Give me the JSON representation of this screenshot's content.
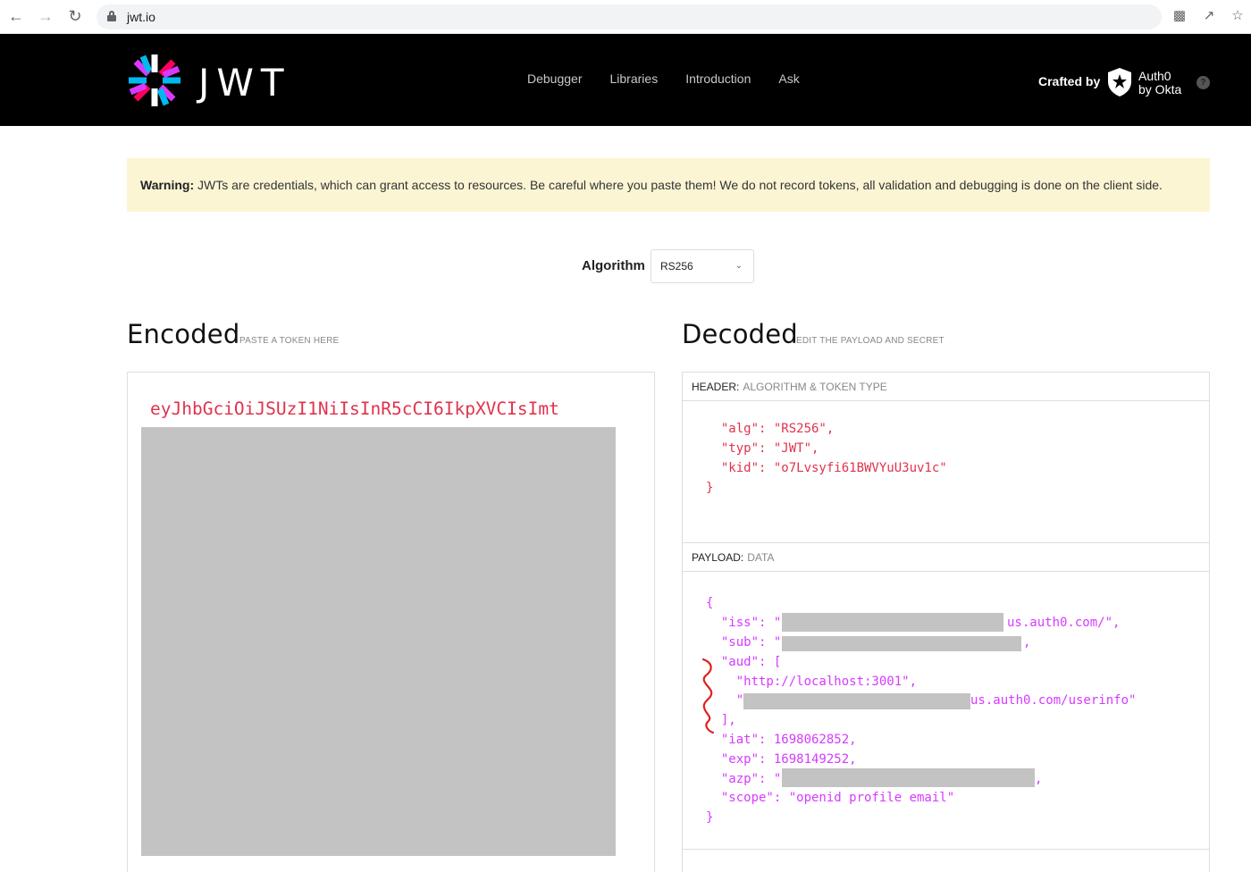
{
  "browser": {
    "url": "jwt.io"
  },
  "header": {
    "logo_text": "JWT",
    "nav": [
      "Debugger",
      "Libraries",
      "Introduction",
      "Ask"
    ],
    "crafted_by": "Crafted by",
    "auth0_line1": "Auth0",
    "auth0_line2": "by Okta",
    "help": "?"
  },
  "warning": {
    "bold": "Warning:",
    "text": " JWTs are credentials, which can grant access to resources. Be careful where you paste them! We do not record tokens, all validation and debugging is done on the client side."
  },
  "algorithm": {
    "label": "Algorithm",
    "selected": "RS256"
  },
  "encoded": {
    "title": "Encoded",
    "subtitle": "PASTE A TOKEN HERE",
    "token_visible": "eyJhbGciOiJSUzI1NiIsInR5cCI6IkpXVCIsImt"
  },
  "decoded": {
    "title": "Decoded",
    "subtitle": "EDIT THE PAYLOAD AND SECRET",
    "header_label": "HEADER:",
    "header_sub": "ALGORITHM & TOKEN TYPE",
    "payload_label": "PAYLOAD:",
    "payload_sub": "DATA",
    "header_lines": [
      "  \"alg\": \"RS256\",",
      "  \"typ\": \"JWT\",",
      "  \"kid\": \"o7Lvsyfi61BWVYuU3uv1c\"",
      "}"
    ],
    "payload_lines": {
      "open": "{",
      "iss_key": "  \"iss\": \"",
      "iss_tail": "us.auth0.com/\",",
      "sub_key": "  \"sub\": \"",
      "sub_tail": ",",
      "aud_key": "  \"aud\": [",
      "aud_1": "    \"http://localhost:3001\",",
      "aud_2_key": "    \"",
      "aud_2_tail": "us.auth0.com/userinfo\"",
      "aud_close": "  ],",
      "iat": "  \"iat\": 1698062852,",
      "exp": "  \"exp\": 1698149252,",
      "azp_key": "  \"azp\": \"",
      "azp_tail": ",",
      "scope": "  \"scope\": \"openid profile email\"",
      "close": "}"
    }
  },
  "colors": {
    "header_bg": "#000000",
    "warning_bg": "#fbf5d4",
    "token_red": "#e0334d",
    "payload_pink": "#d63aff",
    "redaction_gray": "#c3c3c3"
  }
}
